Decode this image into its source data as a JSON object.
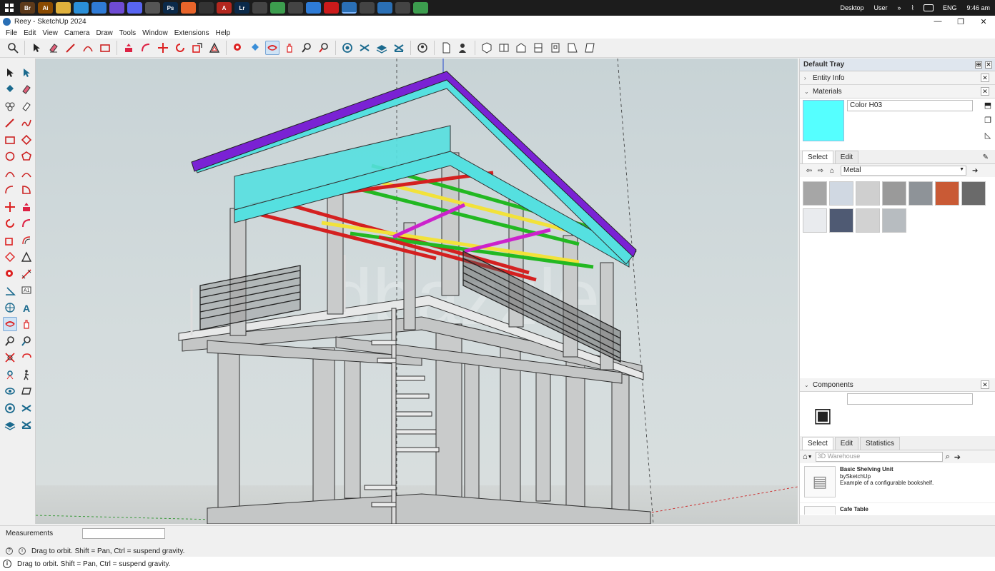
{
  "taskbar": {
    "apps": [
      {
        "icon": "bridge-icon",
        "label": "Br",
        "color": "#5d3a1a"
      },
      {
        "icon": "illustrator-icon",
        "label": "Ai",
        "color": "#8a4a00"
      },
      {
        "icon": "folder-icon",
        "label": "",
        "color": "#e0b13c"
      },
      {
        "icon": "edge-icon",
        "label": "",
        "color": "#2a8fd8"
      },
      {
        "icon": "windows-icon",
        "label": "",
        "color": "#2f7bd6"
      },
      {
        "icon": "viber-icon",
        "label": "",
        "color": "#6e4bd3"
      },
      {
        "icon": "discord-icon",
        "label": "",
        "color": "#5865f2"
      },
      {
        "icon": "github-icon",
        "label": "",
        "color": "#555555"
      },
      {
        "icon": "photoshop-icon",
        "label": "Ps",
        "color": "#0b2a4a"
      },
      {
        "icon": "firefox-icon",
        "label": "",
        "color": "#e8642a"
      },
      {
        "icon": "sketchup-alt-icon",
        "label": "",
        "color": "#333333"
      },
      {
        "icon": "acrobat-icon",
        "label": "A",
        "color": "#b3271e"
      },
      {
        "icon": "lightroom-icon",
        "label": "Lr",
        "color": "#0b2a4a"
      },
      {
        "icon": "calculator-icon",
        "label": "",
        "color": "#444444"
      },
      {
        "icon": "chrome-icon",
        "label": "",
        "color": "#3c9d4e"
      },
      {
        "icon": "app-icon",
        "label": "",
        "color": "#444444"
      },
      {
        "icon": "files-icon",
        "label": "",
        "color": "#2e7bd6"
      },
      {
        "icon": "opera-icon",
        "label": "",
        "color": "#cc1b1b"
      },
      {
        "icon": "sketchup-icon",
        "label": "",
        "color": "#2a6fb5",
        "active": true
      },
      {
        "icon": "sketchup-viewer-icon",
        "label": "",
        "color": "#444444"
      },
      {
        "icon": "layout-icon",
        "label": "",
        "color": "#2a6fb5"
      },
      {
        "icon": "pin-icon",
        "label": "",
        "color": "#444444"
      },
      {
        "icon": "chrome-icon",
        "label": "",
        "color": "#3c9d4e"
      }
    ],
    "tray": {
      "desktop": "Desktop",
      "user": "User",
      "chevron": "»",
      "lang": "ENG",
      "time": "9:46 am"
    }
  },
  "window": {
    "title": "Reey - SketchUp 2024",
    "minimize": "—",
    "maximize": "❐",
    "close": "✕"
  },
  "menu": [
    "File",
    "Edit",
    "View",
    "Camera",
    "Draw",
    "Tools",
    "Window",
    "Extensions",
    "Help"
  ],
  "viewport": {
    "watermark": "dbazzle",
    "colors": {
      "roof": "#7a22d4",
      "glass": "#55e0e0",
      "beam_red": "#d42020",
      "beam_yellow": "#f2e23a",
      "beam_green": "#22b822",
      "concrete": "#c9cbcb",
      "magenta": "#cc22cc"
    }
  },
  "tray": {
    "title": "Default Tray",
    "pin": "⊞",
    "close": "✕",
    "entity_info": {
      "label": "Entity Info",
      "chevron": "›",
      "close": "✕"
    },
    "materials": {
      "label": "Materials",
      "chevron": "⌄",
      "close": "✕",
      "current_name": "Color H03",
      "current_color": "#55ffff",
      "tabs": [
        {
          "label": "Select",
          "selected": true
        },
        {
          "label": "Edit",
          "selected": false
        }
      ],
      "library": "Metal",
      "back": "⇦",
      "forward": "⇨",
      "home": "⌂",
      "details": "➔",
      "swatches": [
        "#a6a6a6",
        "#d0d8e2",
        "#cfcfcf",
        "#9a9a9a",
        "#8e9398",
        "#c95a35",
        "#6a6a6a",
        "#e9ebee",
        "#4f5a73",
        "#d2d2d2",
        "#b7bcc0"
      ]
    },
    "components": {
      "label": "Components",
      "chevron": "⌄",
      "close": "✕",
      "name": "",
      "tabs": [
        {
          "label": "Select",
          "selected": true
        },
        {
          "label": "Edit",
          "selected": false
        },
        {
          "label": "Statistics",
          "selected": false
        }
      ],
      "search_placeholder": "3D Warehouse",
      "results": [
        {
          "title": "Basic Shelving Unit",
          "by": "bySketchUp",
          "desc": "Example of a configurable bookshelf."
        },
        {
          "title": "Cafe Table",
          "by": "",
          "desc": ""
        }
      ]
    }
  },
  "status": {
    "measurements_label": "Measurements",
    "measurements_value": "",
    "hint": "Drag to orbit. Shift = Pan, Ctrl = suspend gravity.",
    "hint2": "Drag to orbit. Shift = Pan, Ctrl = suspend gravity.",
    "help_icon": "?",
    "info_icon": "i"
  }
}
